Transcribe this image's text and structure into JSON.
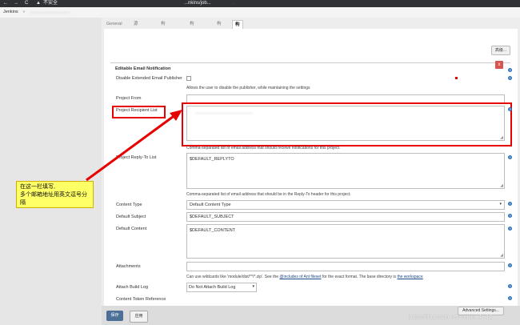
{
  "browser": {
    "back": "←",
    "forward": "→",
    "reload": "C",
    "insecure_label": "不安全",
    "url_tail": "...nkins/job...",
    "suffix": "..."
  },
  "jenkins": {
    "home_label": "Jenkins",
    "breadcrumb_sep": "›",
    "job_name": "................................"
  },
  "tabs": [
    {
      "label": "General"
    },
    {
      "label": "源码管理"
    },
    {
      "label": "构建触发器"
    },
    {
      "label": "构建环境"
    },
    {
      "label": "构建"
    },
    {
      "label": "构建后操作"
    }
  ],
  "top_button": "高级...",
  "section": {
    "title": "Editable Email Notification",
    "close_icon": "x",
    "disable_label": "Disable Extended Email Publisher",
    "disable_desc": "Allows the user to disable the publisher, while maintaining the settings",
    "project_from_label": "Project From",
    "recipient_label": "Project Recipient List",
    "recipient_value": "...........................................",
    "recipient_desc": "Comma-separated list of email address that should receive notifications for this project.",
    "reply_label": "Project Reply-To List",
    "reply_value": "$DEFAULT_REPLYTO",
    "reply_desc": "Comma-separated list of email address that should be in the Reply-To header for this project.",
    "content_type_label": "Content Type",
    "content_type_value": "Default Content Type",
    "subject_label": "Default Subject",
    "subject_value": "$DEFAULT_SUBJECT",
    "content_label": "Default Content",
    "content_value": "$DEFAULT_CONTENT",
    "attachments_label": "Attachments",
    "attachments_desc": "Can use wildcards like 'module/dist/**/*.zip'. See the",
    "attachments_link1": "@includes of Ant fileset",
    "attachments_mid": "for the exact format. The base directory is",
    "attachments_link2": "the workspace",
    "attach_log_label": "Attach Build Log",
    "attach_log_value": "Do Not Attach Build Log",
    "token_label": "Content Token Reference",
    "advanced_button": "Advanced Settings..."
  },
  "callout": {
    "line1": "在这一栏填写,",
    "line2": "多个邮箱地址用英文逗号分隔"
  },
  "footer": {
    "save": "保存",
    "apply": "应用"
  },
  "watermark": "https://blog.csdn.net/weixin_4...12",
  "colors": {
    "annotation_red": "#e60000",
    "callout_yellow": "#ffff66",
    "save_blue": "#4b6f96",
    "help_blue": "#2d6fb7"
  },
  "icons": [
    "back-icon",
    "forward-icon",
    "reload-icon",
    "warning-icon",
    "help-icon",
    "close-icon",
    "dropdown-arrow-icon",
    "resize-grip-icon"
  ]
}
